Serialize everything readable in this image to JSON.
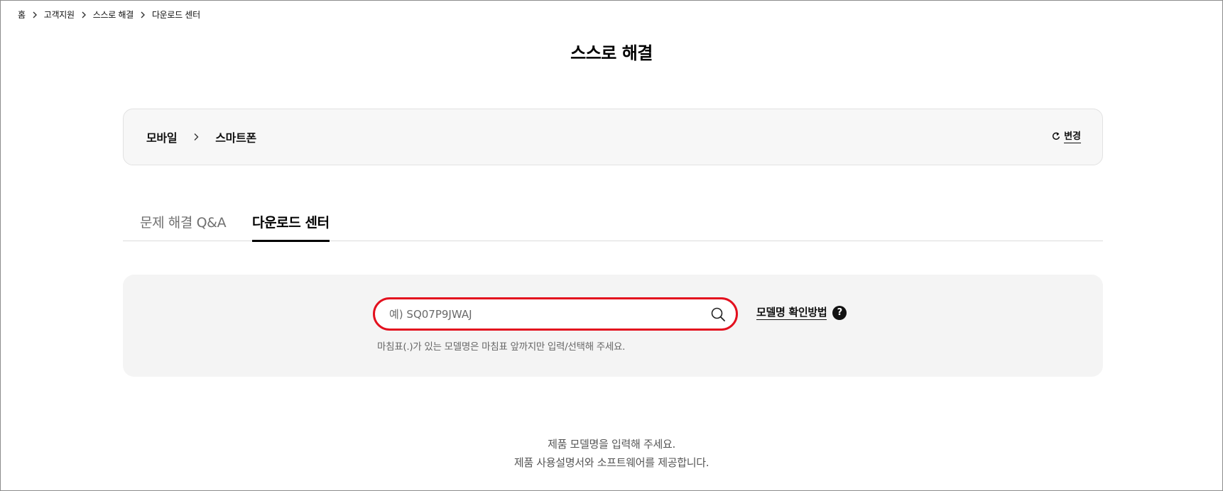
{
  "breadcrumb": {
    "items": [
      "홈",
      "고객지원",
      "스스로 해결",
      "다운로드 센터"
    ]
  },
  "page": {
    "title": "스스로 해결"
  },
  "category": {
    "level1": "모바일",
    "level2": "스마트폰",
    "change_label": "변경",
    "icons": {
      "separator": "chevron-right-icon",
      "change": "refresh-icon"
    }
  },
  "tabs": [
    {
      "label": "문제 해결 Q&A",
      "active": false
    },
    {
      "label": "다운로드 센터",
      "active": true
    }
  ],
  "search": {
    "placeholder": "예) SQ07P9JWAJ",
    "value": "",
    "hint": "마침표(.)가 있는 모델명은 마침표 앞까지만 입력/선택해 주세요.",
    "model_help_label": "모델명 확인방법",
    "help_icon_glyph": "?",
    "highlight_color": "#e3101e",
    "icons": {
      "search": "search-icon",
      "help": "question-circle-icon"
    }
  },
  "footer": {
    "line1": "제품 모델명을 입력해 주세요.",
    "line2": "제품 사용설명서와 소프트웨어를 제공합니다."
  }
}
